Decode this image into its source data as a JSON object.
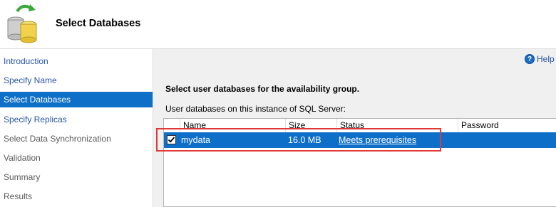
{
  "header": {
    "title": "Select Databases",
    "icon": "database-sync-icon"
  },
  "sidebar": {
    "items": [
      {
        "label": "Introduction",
        "state": "link"
      },
      {
        "label": "Specify Name",
        "state": "link"
      },
      {
        "label": "Select Databases",
        "state": "selected"
      },
      {
        "label": "Specify Replicas",
        "state": "link"
      },
      {
        "label": "Select Data Synchronization",
        "state": "inactive"
      },
      {
        "label": "Validation",
        "state": "inactive"
      },
      {
        "label": "Summary",
        "state": "inactive"
      },
      {
        "label": "Results",
        "state": "inactive"
      }
    ]
  },
  "help": {
    "label": "Help",
    "icon": "help-icon"
  },
  "main": {
    "instruction": "Select user databases for the availability group.",
    "grid_label": "User databases on this instance of SQL Server:",
    "columns": [
      "Name",
      "Size",
      "Status",
      "Password"
    ],
    "rows": [
      {
        "checked": true,
        "name": "mydata",
        "size": "16.0 MB",
        "status": "Meets prerequisites",
        "password": ""
      }
    ]
  },
  "colors": {
    "selection": "#0e6fc9",
    "link": "#2a55a8",
    "highlight": "#e0393a",
    "panel": "#f0f0f0"
  }
}
